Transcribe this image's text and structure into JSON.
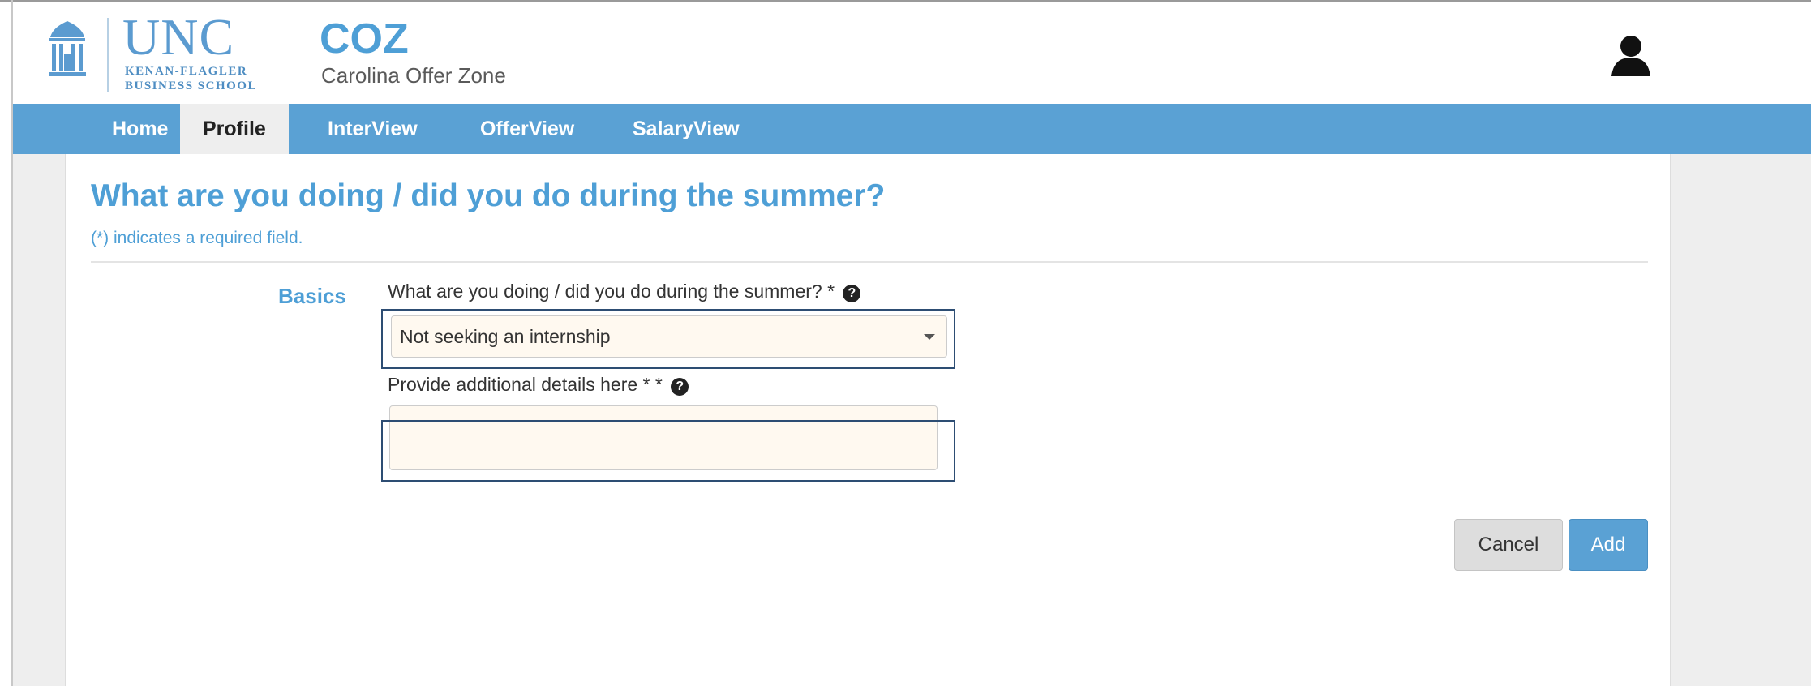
{
  "header": {
    "logo_main": "UNC",
    "logo_line1": "KENAN-FLAGLER",
    "logo_line2": "BUSINESS SCHOOL",
    "app_title": "COZ",
    "app_subtitle": "Carolina Offer Zone",
    "user_icon": "user-icon"
  },
  "nav": {
    "tabs": [
      {
        "label": "Home",
        "active": false
      },
      {
        "label": "Profile",
        "active": true
      },
      {
        "label": "InterView",
        "active": false
      },
      {
        "label": "OfferView",
        "active": false
      },
      {
        "label": "SalaryView",
        "active": false
      }
    ]
  },
  "form": {
    "heading": "What are you doing / did you do during the summer?",
    "required_note": "(*) indicates a required field.",
    "section_label": "Basics",
    "summer_label": "What are you doing / did you do during the summer? *",
    "summer_value": "Not seeking an internship",
    "details_label": "Provide additional details here * *",
    "details_value": "",
    "help_icon": "question-circle-icon"
  },
  "actions": {
    "cancel_label": "Cancel",
    "add_label": "Add"
  },
  "colors": {
    "accent": "#5aa1d4",
    "heading": "#4e9fd6",
    "input_bg": "#fff9f0",
    "focus_border": "#2d4d73"
  }
}
